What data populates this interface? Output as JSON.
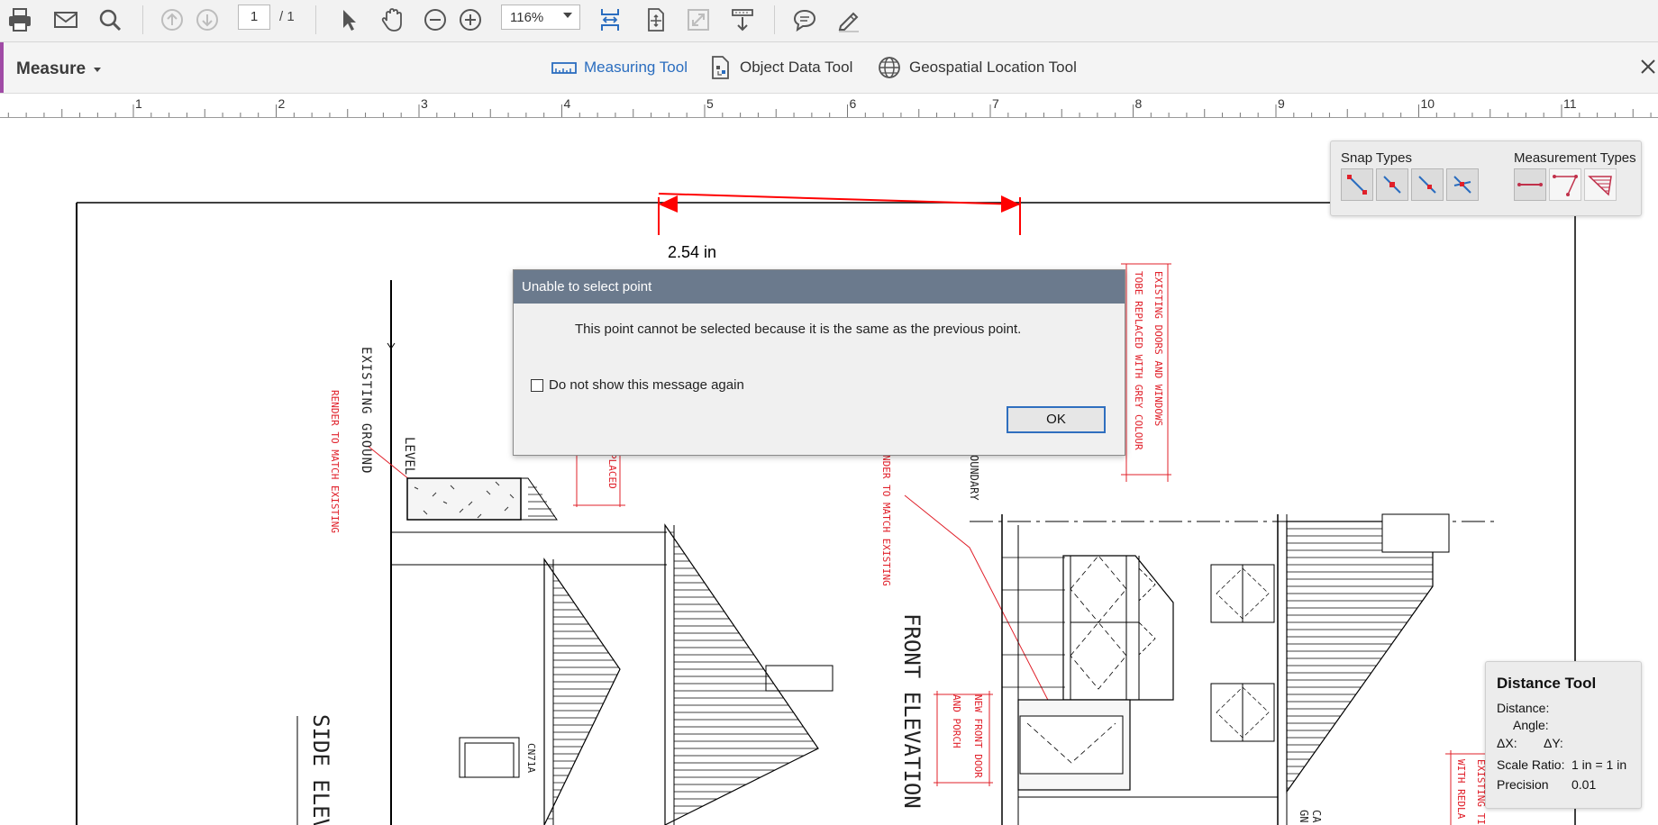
{
  "toolbar": {
    "page_current": "1",
    "page_total": "/ 1",
    "zoom": "116%"
  },
  "measure_bar": {
    "title": "Measure",
    "tools": [
      {
        "label": "Measuring Tool",
        "icon": "ruler-icon",
        "active": true
      },
      {
        "label": "Object Data Tool",
        "icon": "object-data-icon",
        "active": false
      },
      {
        "label": "Geospatial Location Tool",
        "icon": "globe-icon",
        "active": false
      }
    ]
  },
  "ruler": {
    "labels": [
      "1",
      "2",
      "3",
      "4",
      "5",
      "6",
      "7",
      "8",
      "9",
      "10",
      "11"
    ]
  },
  "measurement": {
    "label": "2.54 in",
    "color": "#ff0000"
  },
  "drawing_annotations": {
    "existing_ground": "EXISTING GROUND",
    "level": "LEVEL",
    "render_left": "RENDER TO MATCH EXISTING",
    "placed": "PLACED",
    "s": "S",
    "render_mid": "NDER TO MATCH EXISTING",
    "boundary": "OUNDARY",
    "doors_line1": "EXISTING DOORS AND WINDOWS",
    "doors_line2": "TOBE REPLACED WITH GREY COLOUR",
    "front_elevation": "FRONT ELEVATION",
    "new_front_door": "NEW FRONT DOOR",
    "and_porch": "AND PORCH",
    "side_elevation": "SIDE ELEVA",
    "cn71a": "CN71A",
    "ca": "CA",
    "gn": "GN",
    "existing_til": "EXISTING TIL",
    "with_redla": "WITH REDLA"
  },
  "dialog": {
    "title": "Unable to select point",
    "message": "This point cannot be selected because it is the same as the previous point.",
    "checkbox_label": "Do not show this message again",
    "checkbox_checked": false,
    "ok_label": "OK",
    "title_bar_color": "#6b7a8d"
  },
  "snap_panel": {
    "snap_label": "Snap Types",
    "measurement_label": "Measurement Types",
    "snap_types": [
      "snap-to-endpoints-icon",
      "snap-to-midpoints-icon",
      "snap-to-paths-icon",
      "snap-to-intersections-icon"
    ],
    "measurement_types": [
      "distance-icon",
      "perimeter-icon",
      "area-icon"
    ]
  },
  "distance_tool": {
    "title": "Distance Tool",
    "distance_label": "Distance:",
    "angle_label": "Angle:",
    "dx_label": "ΔX:",
    "dy_label": "ΔY:",
    "scale_label": "Scale Ratio:",
    "scale_value": "1 in = 1 in",
    "precision_label": "Precision",
    "precision_value": "0.01"
  },
  "colors": {
    "accent_purple": "#a04ba6",
    "active_blue": "#2a6dbf",
    "annotation_red": "#e0202a"
  }
}
